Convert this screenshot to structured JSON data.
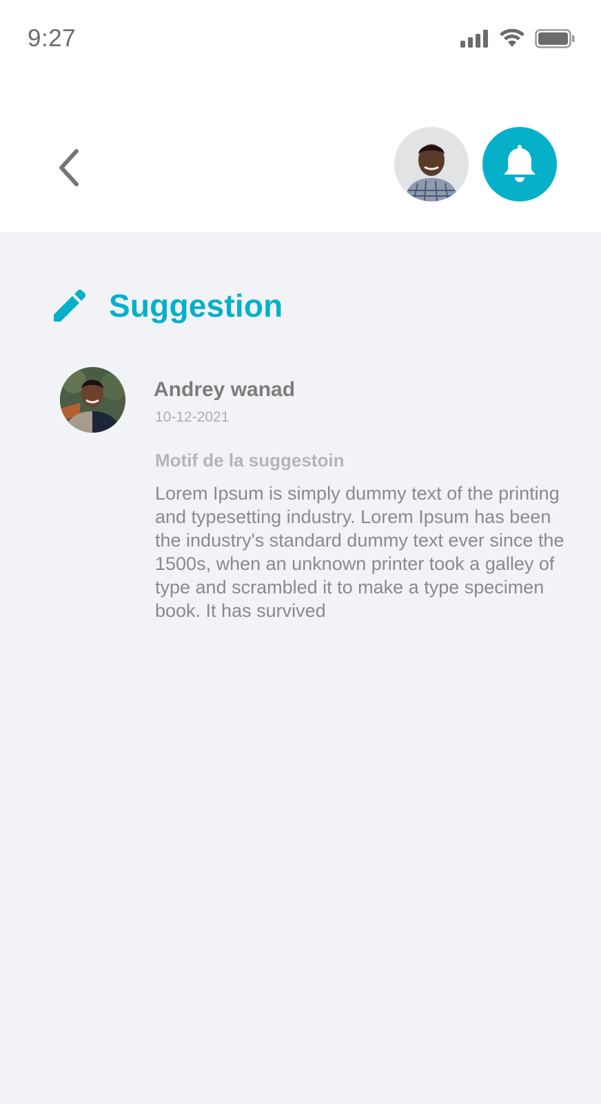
{
  "status_bar": {
    "time": "9:27",
    "icons": [
      "signal-icon",
      "wifi-icon",
      "battery-icon"
    ]
  },
  "header": {
    "back_icon": "chevron-left-icon",
    "notification_icon": "bell-icon",
    "accent_color": "#06b0c9"
  },
  "section": {
    "icon": "pencil-icon",
    "title": "Suggestion"
  },
  "suggestion": {
    "author": "Andrey wanad",
    "date": "10-12-2021",
    "motif_label": "Motif de la suggestoin",
    "body": "Lorem Ipsum is simply dummy text of the printing and typesetting industry. Lorem Ipsum has been the industry's standard dummy text ever since the 1500s, when an unknown printer took a galley of type and scrambled it to make a type specimen book. It has survived"
  },
  "colors": {
    "accent": "#06b0c9",
    "background": "#f2f3f7",
    "header_background": "#ffffff"
  }
}
